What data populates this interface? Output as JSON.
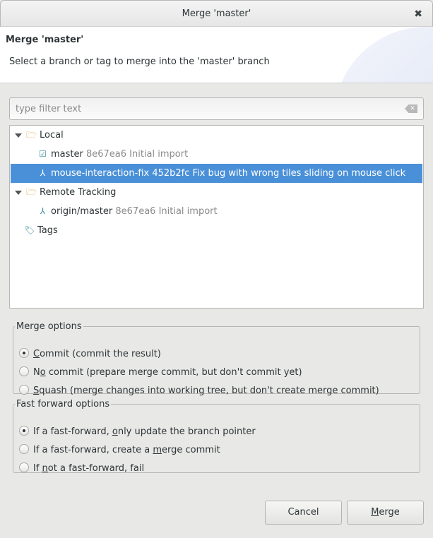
{
  "window": {
    "title": "Merge 'master'",
    "close_icon": "close-icon"
  },
  "header": {
    "title": "Merge 'master'",
    "description": "Select a branch or tag to merge into the 'master' branch"
  },
  "filter": {
    "placeholder": "type filter text",
    "value": ""
  },
  "tree": {
    "local": {
      "label": "Local"
    },
    "master": {
      "name": "master",
      "meta": "8e67ea6 Initial import"
    },
    "mif": {
      "name": "mouse-interaction-fix",
      "meta": "452b2fc Fix bug with wrong tiles sliding on mouse click"
    },
    "remote": {
      "label": "Remote Tracking"
    },
    "origin": {
      "name": "origin/master",
      "meta": "8e67ea6 Initial import"
    },
    "tags": {
      "label": "Tags"
    }
  },
  "merge_options": {
    "legend": "Merge options",
    "selected": "commit",
    "commit": {
      "k": "C",
      "r": "ommit (commit the result)"
    },
    "nocommit": {
      "l": "N",
      "k": "o",
      "r": " commit (prepare merge commit, but don't commit yet)"
    },
    "squash": {
      "k": "S",
      "r": "quash (merge changes into working tree, but don't create merge commit)"
    }
  },
  "ff_options": {
    "legend": "Fast forward options",
    "selected": "ff",
    "ff": {
      "l": "If a fast-forward, ",
      "k": "o",
      "r": "nly update the branch pointer"
    },
    "noff": {
      "l": "If a fast-forward, create a ",
      "k": "m",
      "r": "erge commit"
    },
    "ffonly": {
      "l": "If ",
      "k": "n",
      "r": "ot a fast-forward, fail"
    }
  },
  "buttons": {
    "cancel": "Cancel",
    "merge_k": "M",
    "merge_r": "erge"
  }
}
